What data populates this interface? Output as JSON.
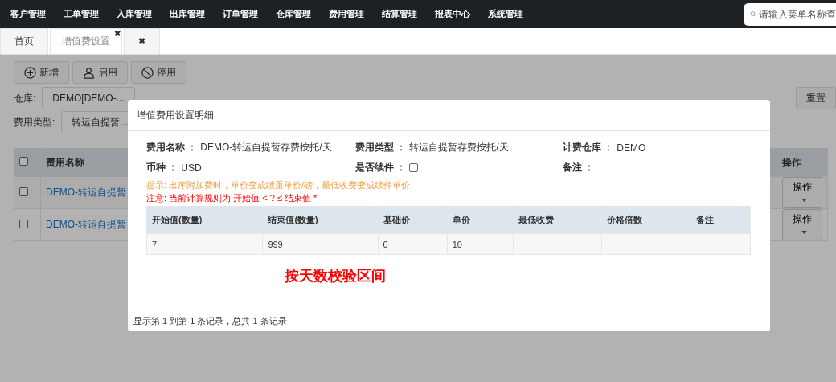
{
  "top_nav": {
    "items": [
      "客户管理",
      "工单管理",
      "入库管理",
      "出库管理",
      "订单管理",
      "仓库管理",
      "费用管理",
      "结算管理",
      "报表中心",
      "系统管理"
    ],
    "search": {
      "placeholder": "请输入菜单名称查"
    }
  },
  "tabs": [
    {
      "label": "首页",
      "selected": false
    },
    {
      "label": "增值费设置",
      "selected": true,
      "close": "✖"
    },
    {
      "label": "✖",
      "selected": false
    }
  ],
  "toolbar": [
    {
      "label": "新增",
      "kind": "plus"
    },
    {
      "label": "启用",
      "kind": "user"
    },
    {
      "label": "停用",
      "kind": "ban"
    }
  ],
  "filters": [
    {
      "label": "仓库:",
      "value": "DEMO[DEMO-..."
    },
    {
      "label": "费用类型:",
      "value": "转运自提暂..."
    }
  ],
  "reset_button": "重置",
  "table": {
    "columns": [
      "费用名称",
      "操作"
    ],
    "header_checked": false,
    "rows": [
      {
        "name": "DEMO-转运自提暂",
        "checked": false,
        "action": "操作"
      },
      {
        "name": "DEMO-转运自提暂",
        "checked": false,
        "action": "操作"
      }
    ]
  },
  "modal": {
    "title": "增值费用设置明细",
    "fields": [
      {
        "label": "费用名称 ：",
        "value": "DEMO-转运自提暂存费按托/天",
        "kind": "text"
      },
      {
        "label": "费用类型 ：",
        "value": "转运自提暂存费按托/天",
        "kind": "text"
      },
      {
        "label": "计费仓库 ：",
        "value": "DEMO",
        "kind": "text"
      },
      {
        "label": "币种 ：",
        "value": "USD",
        "kind": "text"
      },
      {
        "label": "是否续件 ：",
        "kind": "checkbox",
        "checked": false
      },
      {
        "label": "备注 ：",
        "kind": "text"
      }
    ],
    "hint": "提示:  出库附加费时，单价变成续重单价/磅，最低收费变成续件单价",
    "note": "注意:  当前计算规则为 开始值 < ? ≤ 结束值 *",
    "detail_table": {
      "columns": [
        "开始值(数量)",
        "结束值(数量)",
        "基础价",
        "单价",
        "最低收费",
        "价格倍数",
        "备注"
      ],
      "rows": [
        {
          "cells": [
            "7",
            "999",
            "0",
            "10"
          ]
        }
      ]
    },
    "annotation": "按天数校验区间",
    "footer": "显示第 1 到第 1 条记录，总共 1 条记录"
  }
}
